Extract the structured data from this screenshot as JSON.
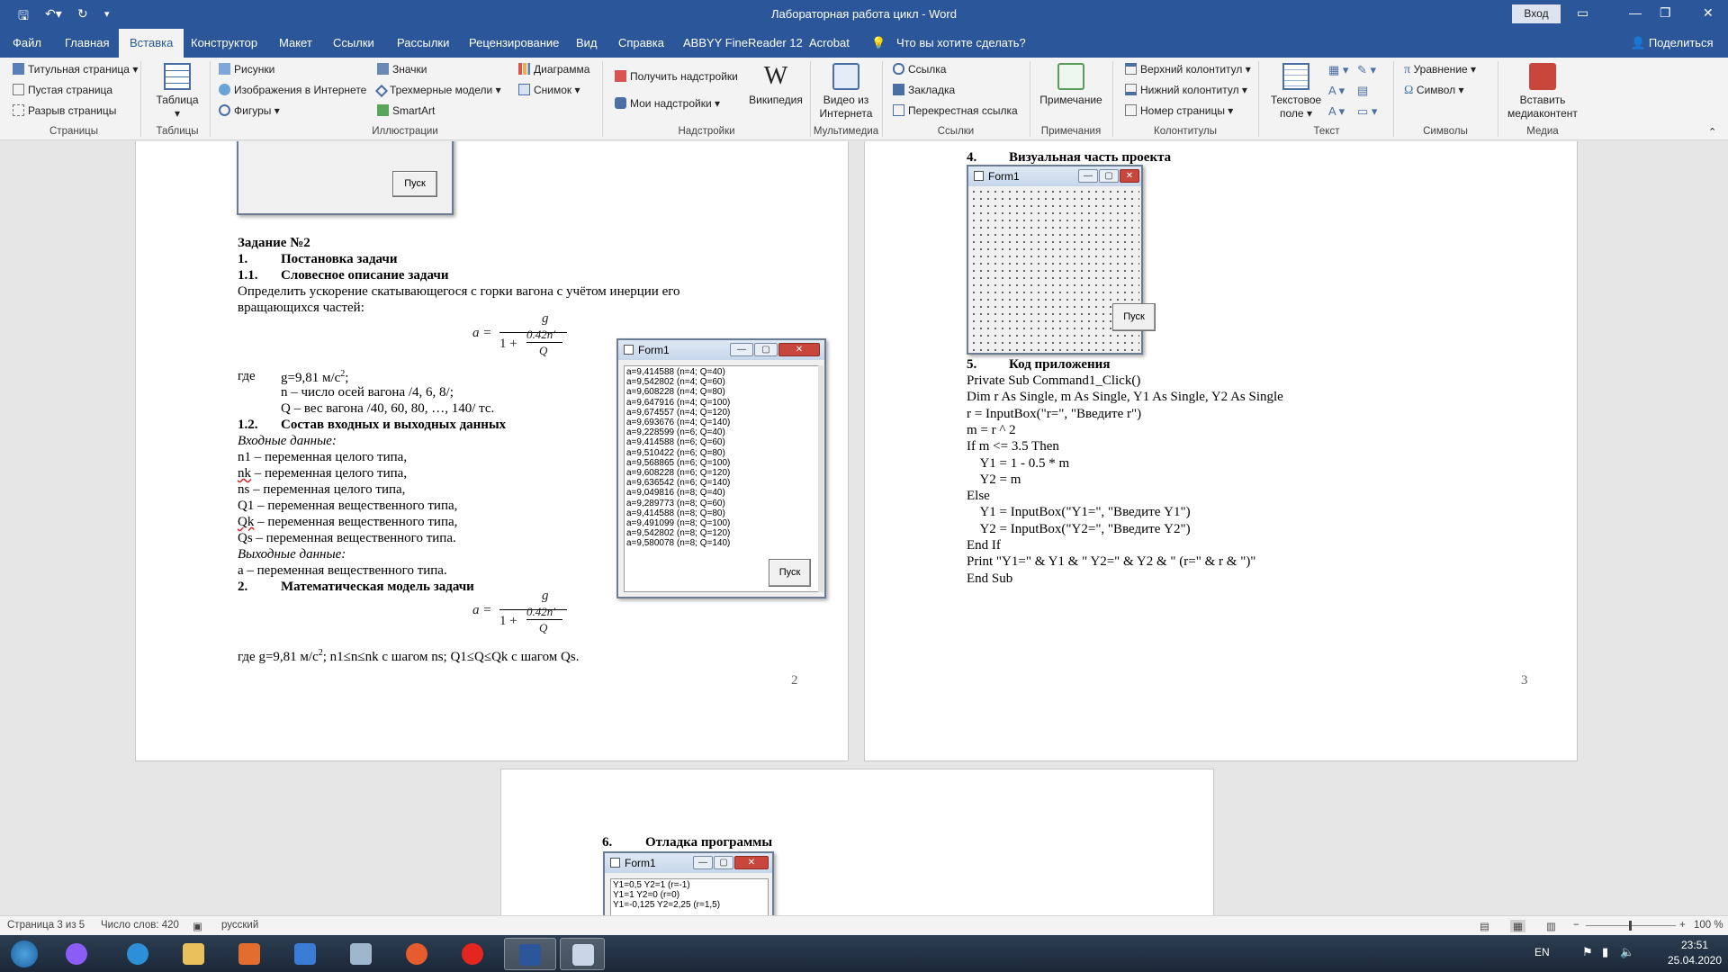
{
  "titlebar": {
    "doc_title": "Лабораторная работа цикл  -  Word",
    "signin_label": "Вход"
  },
  "tabs": [
    "Файл",
    "Главная",
    "Вставка",
    "Конструктор",
    "Макет",
    "Ссылки",
    "Рассылки",
    "Рецензирование",
    "Вид",
    "Справка",
    "ABBYY FineReader 12",
    "Acrobat"
  ],
  "active_tab": "Вставка",
  "tell_me": "Что вы хотите сделать?",
  "share_label": "Поделиться",
  "ribbon": {
    "pages": {
      "title_page": "Титульная страница",
      "blank_page": "Пустая страница",
      "page_break": "Разрыв страницы",
      "group": "Страницы"
    },
    "tables": {
      "table": "Таблица",
      "group": "Таблицы"
    },
    "illustrations": {
      "pictures": "Рисунки",
      "online_pictures": "Изображения в Интернете",
      "shapes": "Фигуры",
      "icons": "Значки",
      "models_3d": "Трехмерные модели",
      "smartart": "SmartArt",
      "chart": "Диаграмма",
      "screenshot": "Снимок",
      "group": "Иллюстрации"
    },
    "addins": {
      "get_addins": "Получить надстройки",
      "my_addins": "Мои надстройки",
      "wikipedia": "Википедия",
      "group": "Надстройки"
    },
    "media_online": {
      "video": "Видео из Интернета",
      "group": "Мультимедиа"
    },
    "links": {
      "link": "Ссылка",
      "bookmark": "Закладка",
      "crossref": "Перекрестная ссылка",
      "group": "Ссылки"
    },
    "comments": {
      "comment": "Примечание",
      "group": "Примечания"
    },
    "header_footer": {
      "header": "Верхний колонтитул",
      "footer": "Нижний колонтитул",
      "page_number": "Номер страницы",
      "group": "Колонтитулы"
    },
    "text": {
      "textbox": "Текстовое поле",
      "group": "Текст"
    },
    "symbols": {
      "equation": "Уравнение",
      "symbol": "Символ",
      "group": "Символы"
    },
    "media": {
      "insert_media": "Вставить медиаконтент",
      "group": "Медиа"
    }
  },
  "page2": {
    "run_button": "Пуск",
    "task_title": "Задание №2",
    "h1": "1.",
    "h1_text": "Постановка задачи",
    "h11": "1.1.",
    "h11_text": "Словесное описание задачи",
    "desc1": "Определить ускорение скатывающегося с горки вагона с учётом инерции его",
    "desc2": "вращающихся частей:",
    "formula_lhs": "a =",
    "formula_num": "g",
    "formula_den_prefix": "1 +",
    "formula_inner_num": "0.42n′",
    "formula_inner_den": "Q",
    "where": "где",
    "g_def": "g=9,81 м/с",
    "g_sup": "2",
    "g_end": ";",
    "n_def": "n – число осей вагона /4, 6, 8/;",
    "q_def": "Q – вес вагона /40, 60, 80, …, 140/ тс.",
    "h12": "1.2.",
    "h12_text": "Состав входных и выходных данных",
    "inputs_label": "Входные данные:",
    "inputs": [
      {
        "n": "n1",
        "d": " – переменная целого типа,"
      },
      {
        "n": "nk",
        "d": " – переменная целого типа,"
      },
      {
        "n": "ns",
        "d": " – переменная целого типа,"
      },
      {
        "n": "Q1",
        "d": " – переменная вещественного типа,"
      },
      {
        "n": "Qk",
        "d": " – переменная вещественного типа,"
      },
      {
        "n": "Qs",
        "d": " – переменная вещественного типа."
      }
    ],
    "outputs_label": "Выходные данные:",
    "output": "a – переменная вещественного типа.",
    "h2": "2.",
    "h2_text": "Математическая модель задачи",
    "where2": "где g=9,81 м/с",
    "where2_sup": "2",
    "where2_rest": "; n1≤n≤nk с шагом ns; Q1≤Q≤Qk с шагом Qs.",
    "page_number": "2"
  },
  "form_results": {
    "caption": "Form1",
    "lines": [
      "a=9,414588 (n=4; Q=40)",
      "a=9,542802 (n=4; Q=60)",
      "a=9,608228 (n=4; Q=80)",
      "a=9,647916 (n=4; Q=100)",
      "a=9,674557 (n=4; Q=120)",
      "a=9,693676 (n=4; Q=140)",
      "a=9,228599 (n=6; Q=40)",
      "a=9,414588 (n=6; Q=60)",
      "a=9,510422 (n=6; Q=80)",
      "a=9,568865 (n=6; Q=100)",
      "a=9,608228 (n=6; Q=120)",
      "a=9,636542 (n=6; Q=140)",
      "a=9,049816 (n=8; Q=40)",
      "a=9,289773 (n=8; Q=60)",
      "a=9,414588 (n=8; Q=80)",
      "a=9,491099 (n=8; Q=100)",
      "a=9,542802 (n=8; Q=120)",
      "a=9,580078 (n=8; Q=140)"
    ],
    "run_button": "Пуск"
  },
  "page3": {
    "h4": "4.",
    "h4_text": "Визуальная часть проекта",
    "form_caption": "Form1",
    "run_button": "Пуск",
    "h5": "5.",
    "h5_text": "Код приложения",
    "code": [
      "Private Sub Command1_Click()",
      "Dim r As Single, m As Single, Y1 As Single, Y2 As Single",
      "r = InputBox(\"r=\", \"Введите r\")",
      "m = r ^ 2",
      "If m <= 3.5 Then",
      "    Y1 = 1 - 0.5 * m",
      "    Y2 = m",
      "Else",
      "    Y1 = InputBox(\"Y1=\", \"Введите Y1\")",
      "    Y2 = InputBox(\"Y2=\", \"Введите Y2\")",
      "End If",
      "Print \"Y1=\" & Y1 & \" Y2=\" & Y2 & \" (r=\" & r & \")\"",
      "End Sub"
    ],
    "page_number": "3"
  },
  "page4": {
    "h6": "6.",
    "h6_text": "Отладка программы",
    "form_caption": "Form1",
    "lines": [
      "Y1=0,5 Y2=1 (r=-1)",
      "Y1=1 Y2=0 (r=0)",
      "Y1=-0,125 Y2=2,25 (r=1,5)"
    ]
  },
  "statusbar": {
    "page": "Страница 3 из 5",
    "words": "Число слов: 420",
    "language": "русский",
    "zoom": "100 %"
  },
  "taskbar": {
    "lang": "EN",
    "time": "23:51",
    "date": "25.04.2020"
  }
}
